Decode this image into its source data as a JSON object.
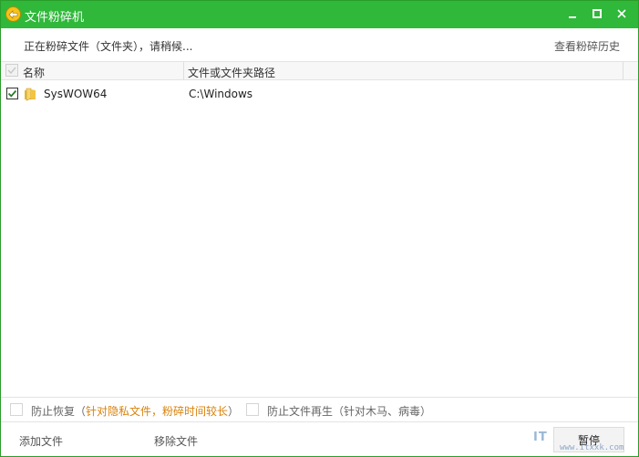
{
  "window": {
    "title": "文件粉碎机",
    "accent_color": "#2fb83a",
    "controls": {
      "minimize": "minimize-icon",
      "maximize": "maximize-icon",
      "close": "close-icon"
    }
  },
  "status": {
    "message": "正在粉碎文件（文件夹），请稍候...",
    "history_link": "查看粉碎历史"
  },
  "table": {
    "columns": [
      "名称",
      "文件或文件夹路径"
    ],
    "rows": [
      {
        "checked": true,
        "icon": "folder-icon",
        "name": "SysWOW64",
        "path": "C:\\Windows"
      }
    ]
  },
  "options": {
    "prevent_recovery": {
      "checked": false,
      "label": "防止恢复（",
      "note": "针对隐私文件，粉碎时间较长",
      "suffix": "）"
    },
    "prevent_regen": {
      "checked": false,
      "label": "防止文件再生（针对木马、病毒）"
    }
  },
  "footer": {
    "add_file": "添加文件",
    "remove_file": "移除文件",
    "pause": "暂停"
  },
  "watermark": {
    "logo": "IT",
    "site": "www.itxxk.com"
  }
}
